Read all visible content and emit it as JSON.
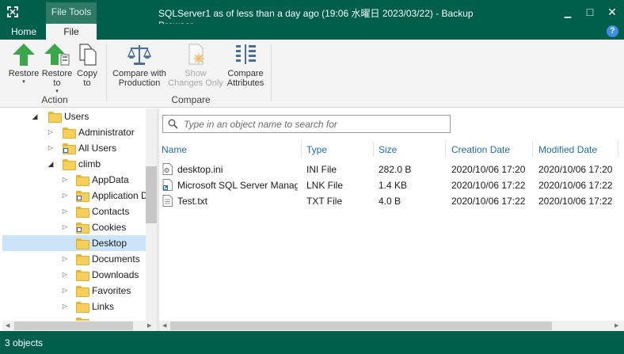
{
  "titlebar": {
    "context_tab": "File Tools",
    "title": "SQLServer1 as of less than a day ago (19:06 水曜日 2023/03/22) - Backup Browser",
    "minimize": "▁",
    "maximize": "□",
    "close": "✕"
  },
  "ribbon_tabs": {
    "home": "Home",
    "file": "File",
    "help": "?"
  },
  "ribbon": {
    "restore": {
      "line1": "Restore",
      "caret": "▾"
    },
    "restore_to": {
      "line1": "Restore",
      "line2": "to",
      "caret": "▾"
    },
    "copy_to": {
      "line1": "Copy",
      "line2": "to"
    },
    "group_action": "Action",
    "compare_production": {
      "line1": "Compare with",
      "line2": "Production"
    },
    "show_changes": {
      "line1": "Show",
      "line2": "Changes Only"
    },
    "compare_attributes": {
      "line1": "Compare",
      "line2": "Attributes"
    },
    "group_compare": "Compare"
  },
  "tree": {
    "nodes": [
      {
        "label": "Users"
      },
      {
        "label": "Administrator"
      },
      {
        "label": "All Users"
      },
      {
        "label": "climb"
      },
      {
        "label": "AppData"
      },
      {
        "label": "Application D"
      },
      {
        "label": "Contacts"
      },
      {
        "label": "Cookies"
      },
      {
        "label": "Desktop"
      },
      {
        "label": "Documents"
      },
      {
        "label": "Downloads"
      },
      {
        "label": "Favorites"
      },
      {
        "label": "Links"
      }
    ],
    "expand_glyph": "◢",
    "collapse_glyph": "▷"
  },
  "search": {
    "placeholder": "Type in an object name to search for"
  },
  "columns": {
    "name": "Name",
    "type": "Type",
    "size": "Size",
    "creation": "Creation Date",
    "modified": "Modified Date"
  },
  "files": [
    {
      "name": "desktop.ini",
      "type": "INI File",
      "size": "282.0 B",
      "created": "2020/10/06 17:20",
      "modified": "2020/10/06 17:20",
      "icon": "settings-file-icon"
    },
    {
      "name": "Microsoft SQL Server Manage...",
      "type": "LNK File",
      "size": "1.4 KB",
      "created": "2020/10/06 17:22",
      "modified": "2020/10/06 17:22",
      "icon": "shortcut-file-icon"
    },
    {
      "name": "Test.txt",
      "type": "TXT File",
      "size": "4.0 B",
      "created": "2020/10/06 17:22",
      "modified": "2020/10/06 17:22",
      "icon": "text-file-icon"
    }
  ],
  "status": {
    "text": "3 objects"
  },
  "colors": {
    "brand": "#005f4b",
    "selection": "#cce4f7",
    "header_text": "#1f6fb0",
    "arrow_green": "#3aa84a"
  }
}
